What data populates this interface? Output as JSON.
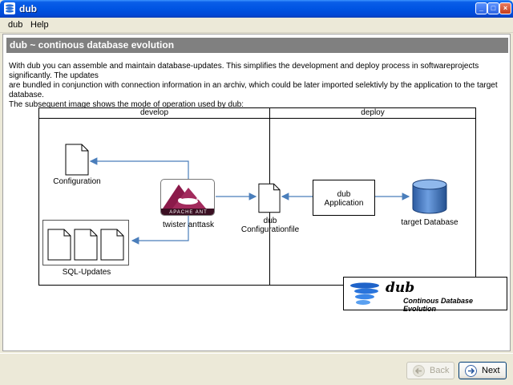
{
  "window": {
    "title": "dub"
  },
  "menu": {
    "items": [
      "dub",
      "Help"
    ]
  },
  "header": {
    "title": "dub ~ continous database evolution"
  },
  "intro": {
    "line1": "With dub you can assemble and maintain database-updates. This simplifies the development and deploy process in softwareprojects significantly. The updates",
    "line2": "are bundled in conjunction with connection information in an archiv, which could be later imported selektivly by the application to the target database.",
    "line3": "The subsequent image shows the mode of operation used by dub:"
  },
  "diagram": {
    "lane_develop": "develop",
    "lane_deploy": "deploy",
    "configuration": "Configuration",
    "sql_updates": "SQL-Updates",
    "twister": "twister anttask",
    "ant_logo": "APACHE ANT",
    "dub_config_line1": "dub",
    "dub_config_line2": "Configurationfile",
    "app_line1": "dub",
    "app_line2": "Application",
    "target_db": "target Database"
  },
  "logo": {
    "name": "dub",
    "tagline": "Continous Database Evolution"
  },
  "buttons": {
    "back": "Back",
    "next": "Next"
  },
  "colors": {
    "titlebar": "#0054e3",
    "arrow": "#4a7ebb",
    "header_band": "#808080",
    "db_blue": "#3f6fb5"
  }
}
